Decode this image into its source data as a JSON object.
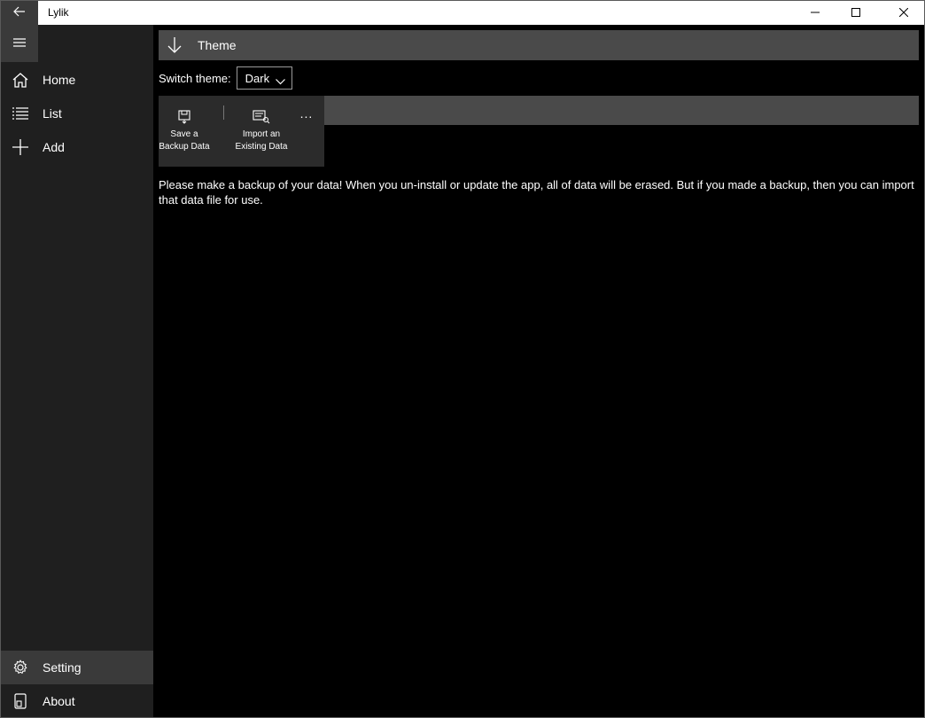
{
  "window": {
    "title": "Lylik"
  },
  "titlebar": {
    "back_icon": "back-arrow-icon",
    "controls": [
      "minimize-icon",
      "maximize-icon",
      "close-icon"
    ]
  },
  "sidebar": {
    "menu_icon": "hamburger-icon",
    "items": [
      {
        "label": "Home",
        "icon": "home-icon"
      },
      {
        "label": "List",
        "icon": "list-icon"
      },
      {
        "label": "Add",
        "icon": "plus-icon"
      }
    ],
    "footer_items": [
      {
        "label": "Setting",
        "icon": "gear-icon",
        "selected": true
      },
      {
        "label": "About",
        "icon": "phone-info-icon"
      }
    ]
  },
  "theme_section": {
    "title": "Theme",
    "icon": "arrow-down-icon",
    "switch_label": "Switch theme:",
    "selected_theme": "Dark"
  },
  "command_bar": {
    "save_label": "Save a Backup Data",
    "import_label": "Import an Existing Data",
    "more_label": "..."
  },
  "notice": "Please make a backup of your data! When you un-install or update the app, all of data will be erased. But if you made a backup, then you can import that data file for use.",
  "colors": {
    "sidebar_bg": "#1f1f1f",
    "header_bg": "#4a4a4a",
    "selected_bg": "#3a3a3a",
    "content_bg": "#000000"
  }
}
